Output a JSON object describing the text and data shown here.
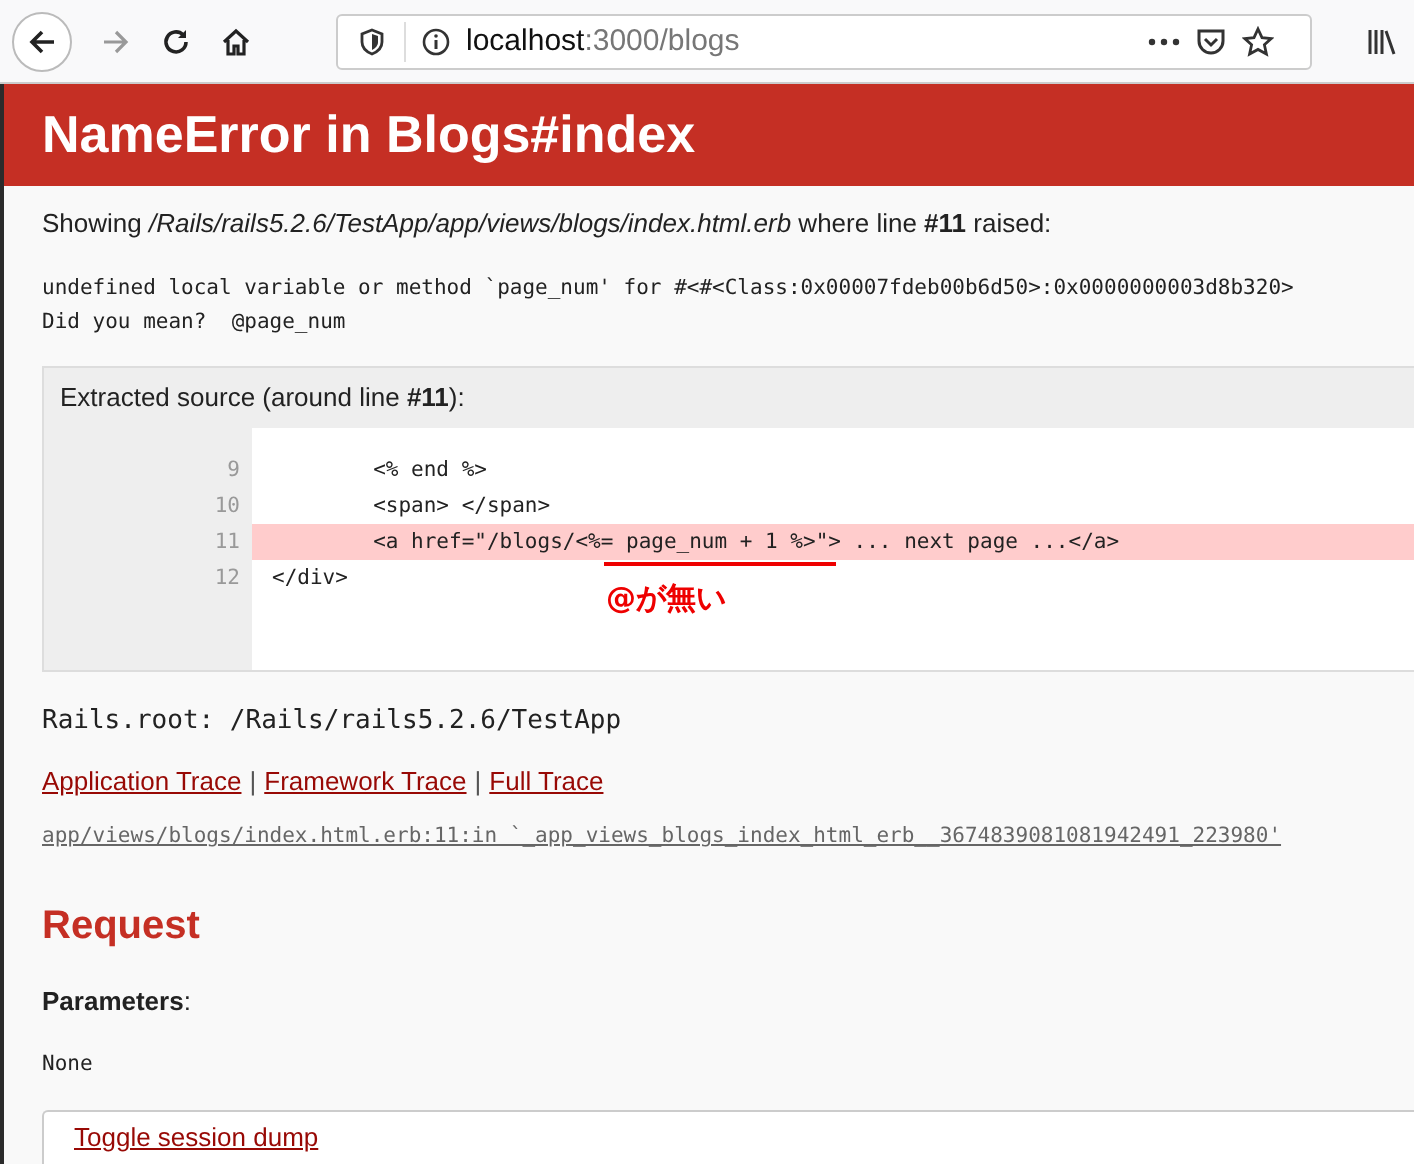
{
  "browser": {
    "url_host": "localhost",
    "url_path": ":3000/blogs"
  },
  "header": {
    "title": "NameError in Blogs#index"
  },
  "showing": "Showing */Rails/rails5.2.6/TestApp/app/views/blogs/index.html.erb* where line **#11** raised:",
  "message": [
    "undefined local variable or method `page_num' for #<#<Class:0x00007fdeb00b6d50>:0x0000000003d8b320>",
    "Did you mean?  @page_num"
  ],
  "source": {
    "title": "Extracted source (around line **#11**):",
    "lines": [
      {
        "number": "9",
        "code": "        <% end %>",
        "highlighted": false
      },
      {
        "number": "10",
        "code": "        <span> </span>",
        "highlighted": false
      },
      {
        "number": "11",
        "code": "        <a href=\"/blogs/<%= page_num + 1 %>\"> ... next page ...</a>",
        "highlighted": true
      },
      {
        "number": "12",
        "code": "</div>",
        "highlighted": false
      }
    ],
    "annotation": "@が無い"
  },
  "rails_root": "Rails.root: /Rails/rails5.2.6/TestApp",
  "trace_links": [
    "Application Trace",
    "Framework Trace",
    "Full Trace"
  ],
  "trace_separator": "|",
  "trace_line": "app/views/blogs/index.html.erb:11:in `_app_views_blogs_index_html_erb__3674839081081942491_223980'",
  "request": {
    "heading": "Request",
    "parameters_label": "**Parameters**:",
    "parameters_value": "None",
    "toggle": "Toggle session dump"
  }
}
